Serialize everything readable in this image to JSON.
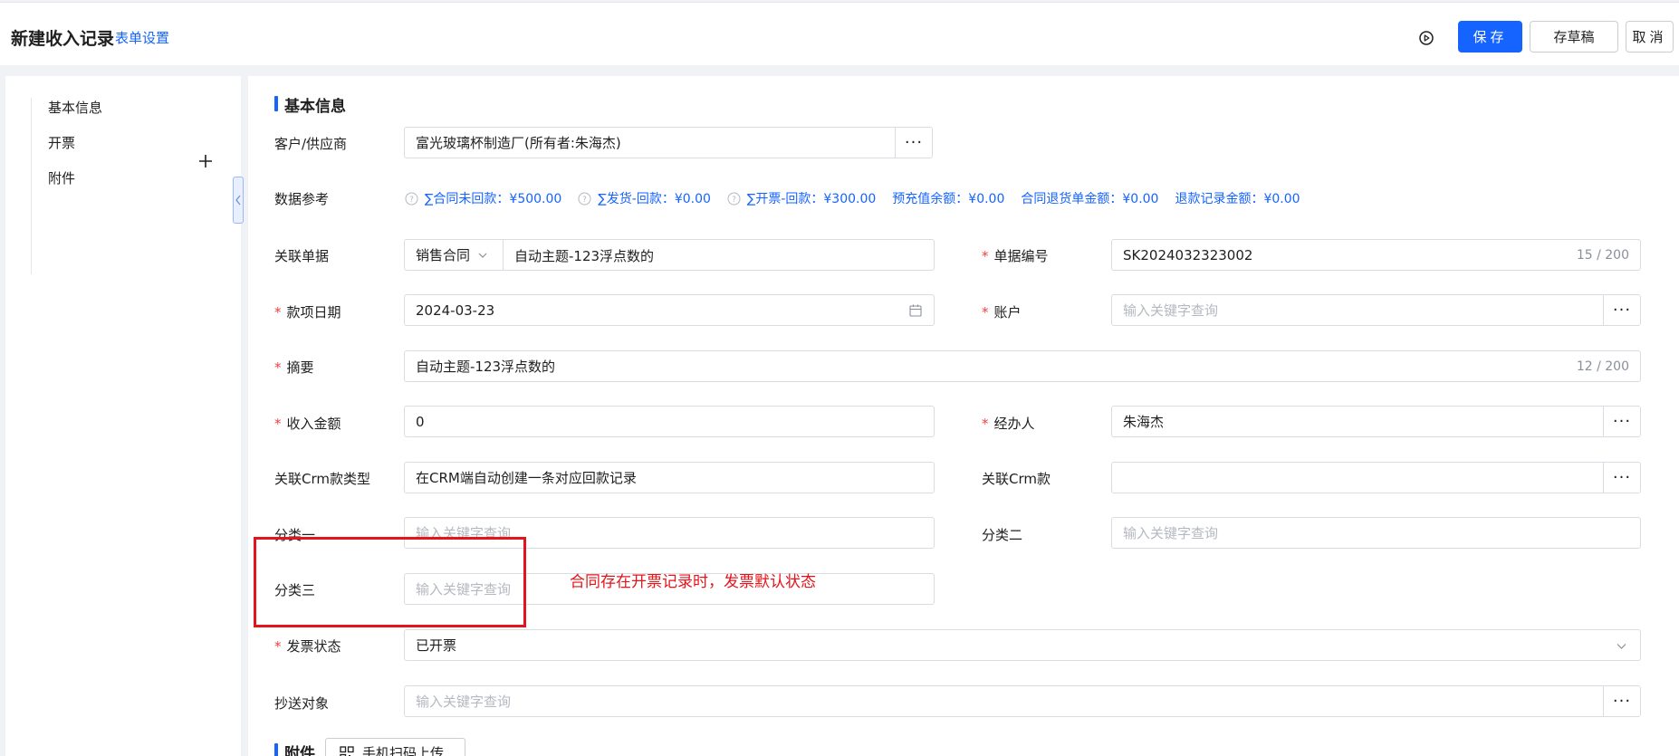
{
  "header": {
    "title": "新建收入记录",
    "form_settings": "表单设置",
    "save": "保存",
    "save_draft": "存草稿",
    "cancel": "取消"
  },
  "sidenav": {
    "items": [
      {
        "label": "基本信息"
      },
      {
        "label": "开票"
      },
      {
        "label": "附件"
      }
    ]
  },
  "section_basic": "基本信息",
  "section_attach": "附件",
  "fields": {
    "customer": {
      "label": "客户/供应商",
      "value": "富光玻璃杯制造厂(所有者:朱海杰)"
    },
    "data_ref": {
      "label": "数据参考",
      "items": [
        {
          "text": "∑合同未回款：¥500.00",
          "help": true
        },
        {
          "text": "∑发货-回款：¥0.00",
          "help": true
        },
        {
          "text": "∑开票-回款：¥300.00",
          "help": true
        },
        {
          "text": "预充值余额：¥0.00",
          "help": false
        },
        {
          "text": "合同退货单金额：¥0.00",
          "help": false
        },
        {
          "text": "退款记录金额：¥0.00",
          "help": false
        }
      ]
    },
    "related_doc": {
      "label": "关联单据",
      "type": "销售合同",
      "value": "自动主题-123浮点数的"
    },
    "doc_no": {
      "label": "单据编号",
      "value": "SK2024032323002",
      "count": "15 / 200"
    },
    "date": {
      "label": "款项日期",
      "value": "2024-03-23"
    },
    "account": {
      "label": "账户",
      "placeholder": "输入关键字查询"
    },
    "summary": {
      "label": "摘要",
      "value": "自动主题-123浮点数的",
      "count": "12 / 200"
    },
    "amount": {
      "label": "收入金额",
      "value": "0"
    },
    "handler": {
      "label": "经办人",
      "value": "朱海杰"
    },
    "crm_type": {
      "label": "关联Crm款类型",
      "value": "在CRM端自动创建一条对应回款记录"
    },
    "crm": {
      "label": "关联Crm款",
      "value": ""
    },
    "cat1": {
      "label": "分类一",
      "placeholder": "输入关键字查询"
    },
    "cat2": {
      "label": "分类二",
      "placeholder": "输入关键字查询"
    },
    "cat3": {
      "label": "分类三",
      "placeholder": "输入关键字查询"
    },
    "invoice_status": {
      "label": "发票状态",
      "value": "已开票"
    },
    "cc": {
      "label": "抄送对象",
      "placeholder": "输入关键字查询"
    }
  },
  "annotation": "合同存在开票记录时，发票默认状态",
  "scan_upload": "手机扫码上传",
  "colors": {
    "primary": "#1664ff",
    "required": "#f53f3f",
    "annotation": "#e4141b"
  }
}
